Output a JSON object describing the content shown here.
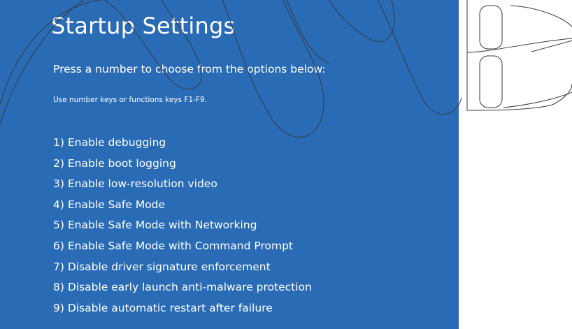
{
  "screen": {
    "title": "Startup Settings",
    "subtitle": "Press a number to choose from the options below:",
    "hint": "Use number keys or functions keys F1-F9.",
    "options": [
      "1) Enable debugging",
      "2) Enable boot logging",
      "3) Enable low-resolution video",
      "4) Enable Safe Mode",
      "5) Enable Safe Mode with Networking",
      "6) Enable Safe Mode with Command Prompt",
      "7) Disable driver signature enforcement",
      "8) Disable early launch anti-malware protection",
      "9) Disable automatic restart after failure"
    ]
  },
  "colors": {
    "background": "#2a6bb6",
    "text": "#ffffff",
    "page": "#ffffff",
    "watermark_stroke": "#3a3a3a"
  }
}
